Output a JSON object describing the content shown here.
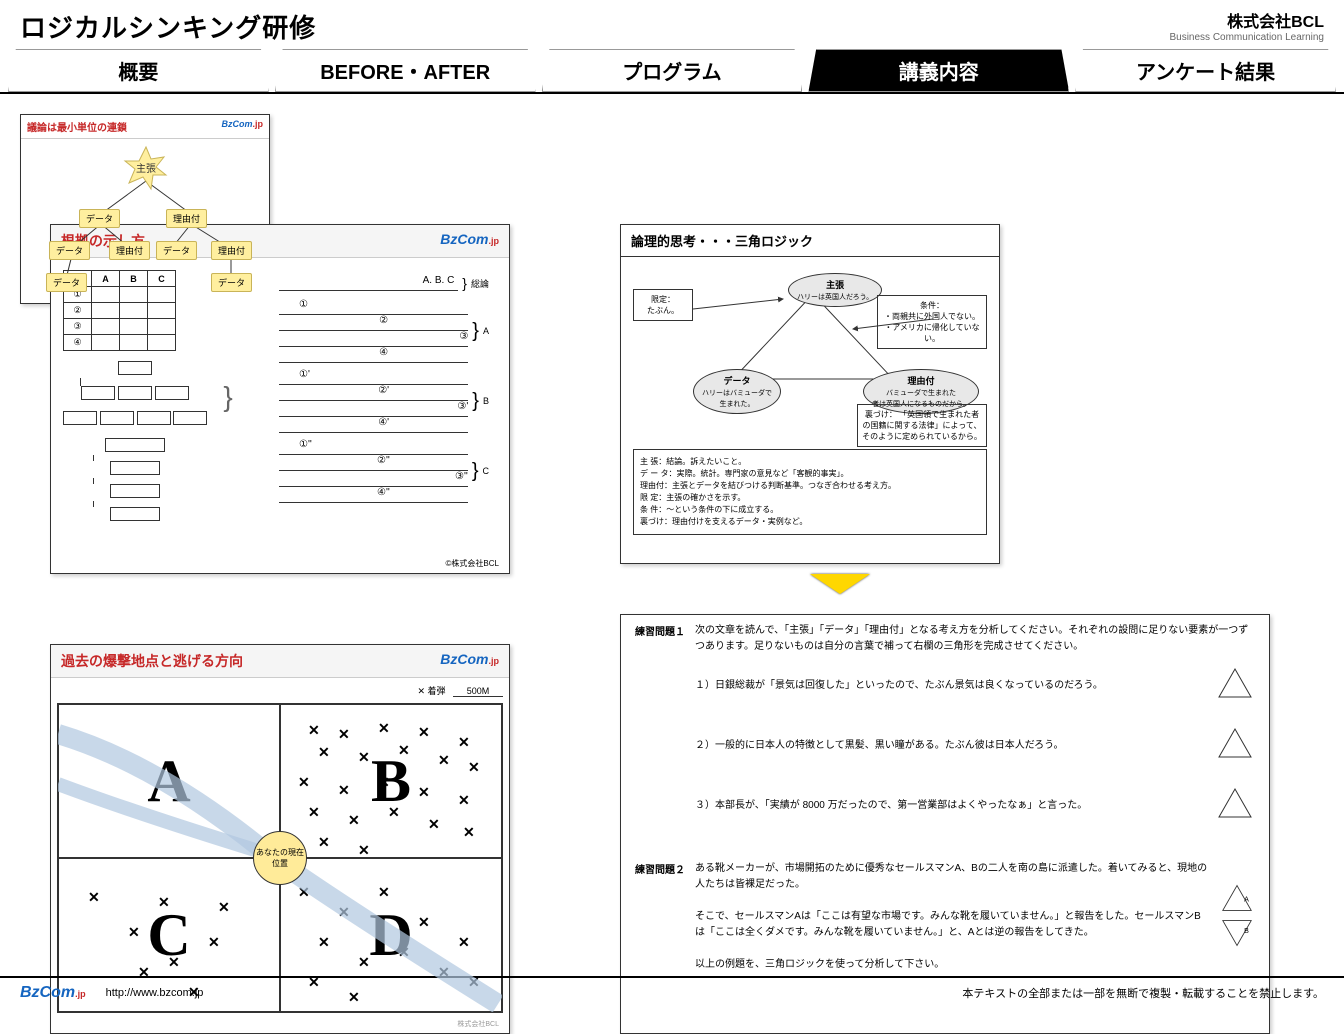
{
  "title": "ロジカルシンキング研修",
  "company": {
    "name": "株式会社BCL",
    "sub": "Business Communication Learning"
  },
  "tabs": [
    "概要",
    "BEFORE・AFTER",
    "プログラム",
    "講義内容",
    "アンケート結果"
  ],
  "active_tab": 3,
  "panel1": {
    "title": "根拠の示し方",
    "brand": "BzCom",
    "table_headers": [
      "",
      "A",
      "B",
      "C"
    ],
    "table_rows": [
      "①",
      "②",
      "③",
      "④"
    ],
    "right_top": "A. B. C",
    "right_top_label": "総論",
    "groups": [
      {
        "label": "A",
        "lines": [
          "①",
          "②",
          "③",
          "④"
        ]
      },
      {
        "label": "B",
        "lines": [
          "①'",
          "②'",
          "③'",
          "④'"
        ]
      },
      {
        "label": "C",
        "lines": [
          "①''",
          "②''",
          "③''",
          "④''"
        ]
      }
    ],
    "copyright": "©株式会社BCL"
  },
  "panel2": {
    "title": "過去の爆撃地点と逃げる方向",
    "brand": "BzCom",
    "legend_marker": "✕ 着弾",
    "legend_scale": "500M",
    "quadrants": [
      "A",
      "B",
      "C",
      "D"
    ],
    "center": "あなたの現在位置",
    "copyright": "株式会社BCL"
  },
  "panel3": {
    "title": "論理的思考・・・三角ロジック",
    "nodes": {
      "claim": "主張",
      "claim_sub": "ハリーは英国人だろう。",
      "limit": "限定：\nたぶん。",
      "cond": "条件：\n・両親共に外国人でない。\n・アメリカに帰化していない。",
      "data": "データ",
      "data_sub": "ハリーはバミューダで\n生まれた。",
      "reason": "理由付",
      "reason_sub": "バミューダで生まれた\n者は英国人になるものだから。",
      "backing": "裏づけ：\n「英国領で生まれた者の国籍に関する法律」によって、そのように定められているから。"
    },
    "definitions": [
      "主 張：結論。訴えたいこと。",
      "デ ー タ：実際。統計。専門家の意見など「客観的事実」。",
      "理由付：主張とデータを結びつける判断基準。つなぎ合わせる考え方。",
      "限 定：主張の確かさを示す。",
      "条 件：～という条件の下に成立する。",
      "裏づけ：理由付けを支えるデータ・実例など。"
    ]
  },
  "panel4": {
    "title": "議論は最小単位の連鎖",
    "brand": "BzCom",
    "center": "主張",
    "tags": [
      "データ",
      "理由付",
      "データ",
      "理由付",
      "データ",
      "理由付",
      "データ",
      "データ"
    ]
  },
  "panel5": {
    "ex1_label": "練習問題１",
    "ex1_intro": "次の文章を読んで、「主張」「データ」「理由付」となる考え方を分析してください。それぞれの設問に足りない要素が一つずつあります。足りないものは自分の言葉で補って右欄の三角形を完成させてください。",
    "ex1_items": [
      "１）日銀総裁が「景気は回復した」といったので、たぶん景気は良くなっているのだろう。",
      "２）一般的に日本人の特徴として黒髪、黒い瞳がある。たぶん彼は日本人だろう。",
      "３）本部長が、「実績が 8000 万だったので、第一営業部はよくやったなぁ」と言った。"
    ],
    "ex2_label": "練習問題２",
    "ex2_body": "ある靴メーカーが、市場開拓のために優秀なセールスマンA、Bの二人を南の島に派遣した。着いてみると、現地の人たちは皆裸足だった。\n\nそこで、セールスマンAは「ここは有望な市場です。みんな靴を履いていません。」と報告をした。セールスマンBは「ここは全くダメです。みんな靴を履いていません。」と、Aとは逆の報告をしてきた。\n\n以上の例題を、三角ロジックを使って分析して下さい。",
    "ex2_tri_labels": [
      "A",
      "B"
    ]
  },
  "footer": {
    "brand": "BzCom",
    "url": "http://www.bzcom.jp",
    "notice": "本テキストの全部または一部を無断で複製・転載することを禁止します。"
  }
}
